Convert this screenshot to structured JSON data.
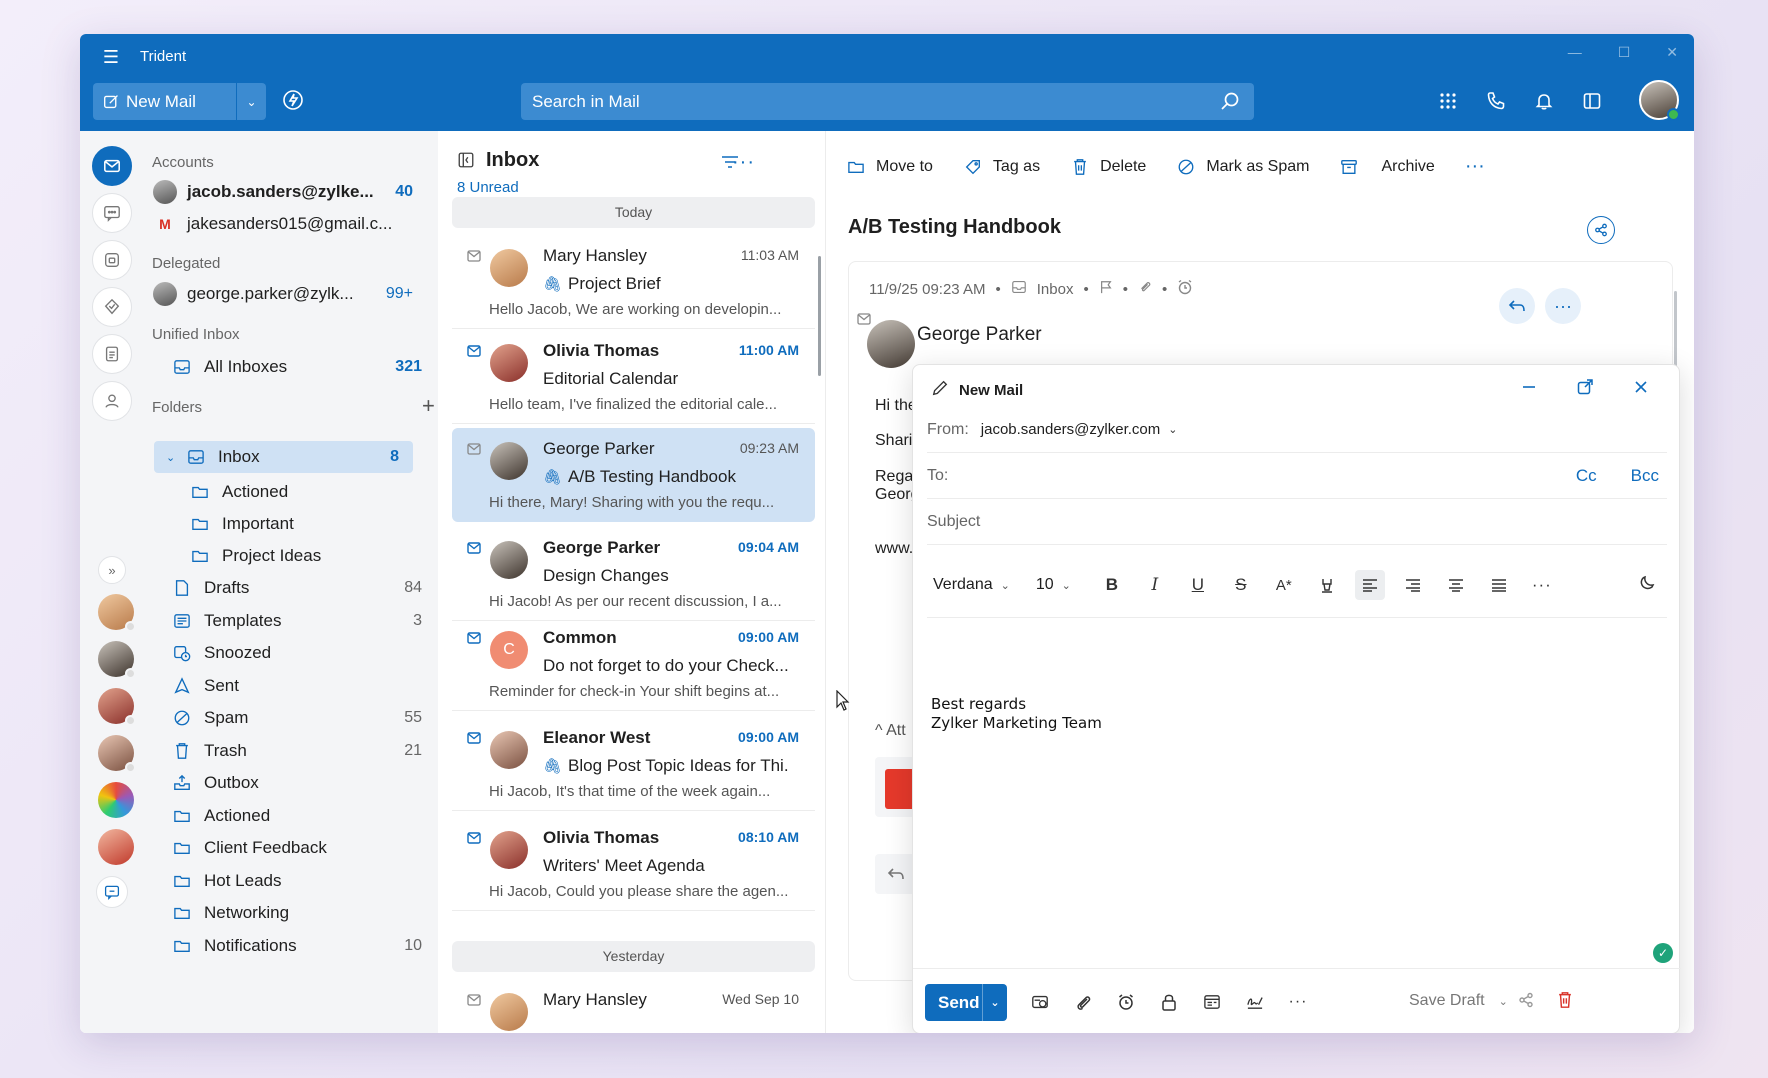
{
  "app": {
    "title": "Trident",
    "new_mail_label": "New Mail",
    "search_placeholder": "Search in Mail"
  },
  "folders": {
    "accounts_label": "Accounts",
    "accounts": [
      {
        "email": "jacob.sanders@zylke...",
        "count": "40"
      },
      {
        "email": "jakesanders015@gmail.c...",
        "count": ""
      }
    ],
    "delegated_label": "Delegated",
    "delegated": {
      "email": "george.parker@zylk...",
      "count": "99+"
    },
    "unified_label": "Unified Inbox",
    "all_inboxes": {
      "label": "All Inboxes",
      "count": "321"
    },
    "folders_label": "Folders",
    "inbox": {
      "label": "Inbox",
      "count": "8"
    },
    "subfolders": [
      "Actioned",
      "Important",
      "Project Ideas"
    ],
    "items": [
      {
        "label": "Drafts",
        "count": "84"
      },
      {
        "label": "Templates",
        "count": "3"
      },
      {
        "label": "Snoozed",
        "count": ""
      },
      {
        "label": "Sent",
        "count": ""
      },
      {
        "label": "Spam",
        "count": "55"
      },
      {
        "label": "Trash",
        "count": "21"
      },
      {
        "label": "Outbox",
        "count": ""
      },
      {
        "label": "Actioned",
        "count": ""
      },
      {
        "label": "Client Feedback",
        "count": ""
      },
      {
        "label": "Hot Leads",
        "count": ""
      },
      {
        "label": "Networking",
        "count": ""
      },
      {
        "label": "Notifications",
        "count": "10"
      }
    ]
  },
  "mail_list": {
    "title": "Inbox",
    "unread": "8 Unread",
    "today_label": "Today",
    "yesterday_label": "Yesterday",
    "items": [
      {
        "from": "Mary Hansley",
        "time": "11:03 AM",
        "subject": "Project Brief",
        "preview": "Hello Jacob, We are working on developin..."
      },
      {
        "from": "Olivia Thomas",
        "time": "11:00 AM",
        "subject": "Editorial Calendar",
        "preview": "Hello team, I've finalized the editorial cale..."
      },
      {
        "from": "George Parker",
        "time": "09:23 AM",
        "subject": "A/B Testing Handbook",
        "preview": "Hi there, Mary! Sharing with you the requ..."
      },
      {
        "from": "George Parker",
        "time": "09:04 AM",
        "subject": "Design Changes",
        "preview": "Hi Jacob! As per our recent discussion, I a..."
      },
      {
        "from": "Common",
        "time": "09:00 AM",
        "subject": "Do not forget to do your Check...",
        "preview": "Reminder for check-in Your shift begins at..."
      },
      {
        "from": "Eleanor West",
        "time": "09:00 AM",
        "subject": "Blog Post Topic Ideas for Thi...",
        "preview": "Hi Jacob, It's that time of the week again..."
      },
      {
        "from": "Olivia Thomas",
        "time": "08:10 AM",
        "subject": "Writers' Meet Agenda",
        "preview": "Hi Jacob, Could you please share the agen..."
      },
      {
        "from": "Mary Hansley",
        "time": "Wed Sep 10",
        "subject": "",
        "preview": ""
      }
    ],
    "common_initial": "C"
  },
  "reader": {
    "toolbar": {
      "move_to": "Move to",
      "tag_as": "Tag as",
      "delete": "Delete",
      "mark_spam": "Mark as Spam",
      "archive": "Archive"
    },
    "subject": "A/B Testing Handbook",
    "datetime": "11/9/25 09:23 AM",
    "folder": "Inbox",
    "sender": "George Parker",
    "body_fragments": [
      "Hi the",
      "Shari",
      "Rega",
      "Georg",
      "www.",
      "Att"
    ]
  },
  "compose": {
    "title": "New Mail",
    "from_label": "From:",
    "from_value": "jacob.sanders@zylker.com",
    "to_label": "To:",
    "cc": "Cc",
    "bcc": "Bcc",
    "subject_placeholder": "Subject",
    "font": "Verdana",
    "size": "10",
    "signature_line1": "Best regards",
    "signature_line2": "Zylker Marketing Team",
    "send": "Send",
    "save_draft": "Save Draft"
  }
}
